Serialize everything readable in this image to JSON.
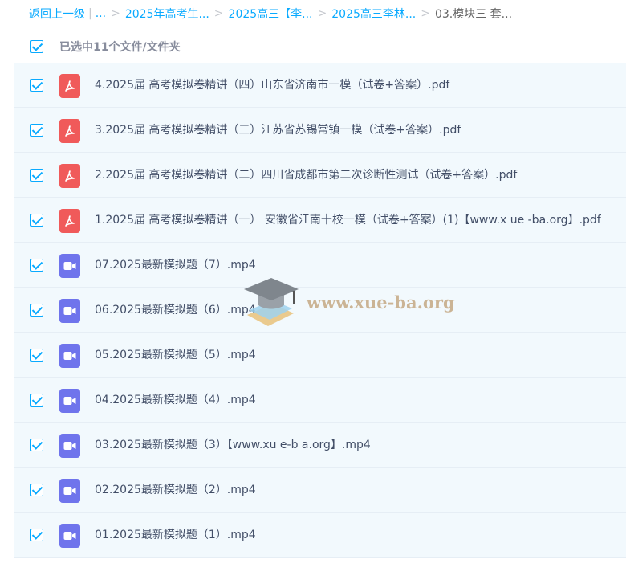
{
  "breadcrumb": {
    "back_label": "返回上一级",
    "pipe": "|",
    "ellipsis": "...",
    "items": [
      "2025年高考生...",
      "2025高三【李...",
      "2025高三李林..."
    ],
    "current": "03.模块三 套...",
    "separator": ">"
  },
  "selection": {
    "text": "已选中11个文件/文件夹"
  },
  "watermark": {
    "text": "www.xue-ba.org"
  },
  "files": [
    {
      "name": "4.2025届 高考模拟卷精讲（四）山东省济南市一模（试卷+答案）.pdf",
      "type": "pdf",
      "icon": "pdf-file-icon"
    },
    {
      "name": "3.2025届 高考模拟卷精讲（三）江苏省苏锡常镇一模（试卷+答案）.pdf",
      "type": "pdf",
      "icon": "pdf-file-icon"
    },
    {
      "name": "2.2025届 高考模拟卷精讲（二）四川省成都市第二次诊断性测试（试卷+答案）.pdf",
      "type": "pdf",
      "icon": "pdf-file-icon"
    },
    {
      "name": "1.2025届 高考模拟卷精讲（一） 安徽省江南十校一模（试卷+答案）(1)【www.x ue -ba.org】.pdf",
      "type": "pdf",
      "icon": "pdf-file-icon"
    },
    {
      "name": "07.2025最新模拟题（7）.mp4",
      "type": "video",
      "icon": "video-file-icon"
    },
    {
      "name": "06.2025最新模拟题（6）.mp4",
      "type": "video",
      "icon": "video-file-icon"
    },
    {
      "name": "05.2025最新模拟题（5）.mp4",
      "type": "video",
      "icon": "video-file-icon"
    },
    {
      "name": "04.2025最新模拟题（4）.mp4",
      "type": "video",
      "icon": "video-file-icon"
    },
    {
      "name": "03.2025最新模拟题（3）【www.xu e-b a.org】.mp4",
      "type": "video",
      "icon": "video-file-icon"
    },
    {
      "name": "02.2025最新模拟题（2）.mp4",
      "type": "video",
      "icon": "video-file-icon"
    },
    {
      "name": "01.2025最新模拟题（1）.mp4",
      "type": "video",
      "icon": "video-file-icon"
    }
  ],
  "colors": {
    "accent": "#09aaff",
    "row_bg": "#f2f9fd",
    "pdf": "#f05a5a",
    "video": "#6f74ec"
  }
}
